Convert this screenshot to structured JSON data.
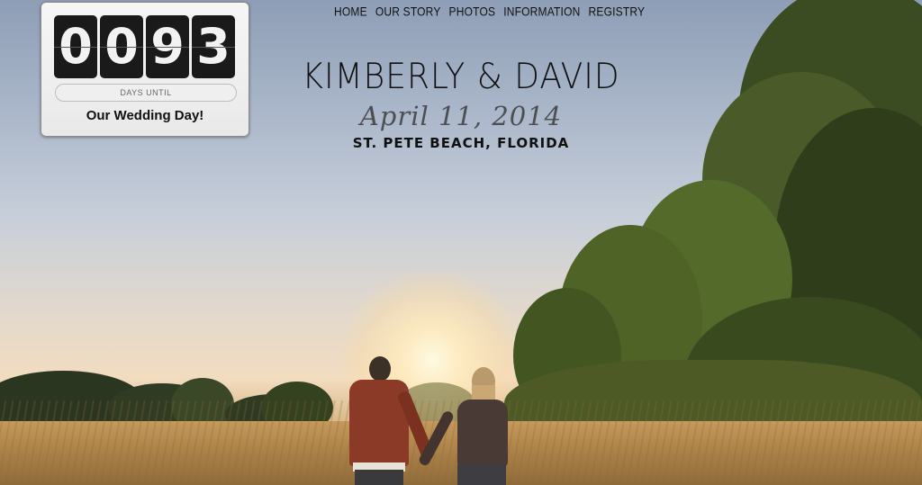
{
  "countdown": {
    "digits": [
      "0",
      "0",
      "9",
      "3"
    ],
    "days_label": "DAYS UNTIL",
    "title": "Our Wedding Day!"
  },
  "nav": {
    "items": [
      "HOME",
      "OUR STORY",
      "PHOTOS",
      "INFORMATION",
      "REGISTRY"
    ]
  },
  "hero": {
    "names": "KIMBERLY & DAVID",
    "date": "April 11, 2014",
    "location": "ST. PETE BEACH, FLORIDA"
  },
  "colors": {
    "text": "#111111",
    "widget_bg": "#f0f0f0",
    "digit_bg": "#1a1a1a"
  }
}
